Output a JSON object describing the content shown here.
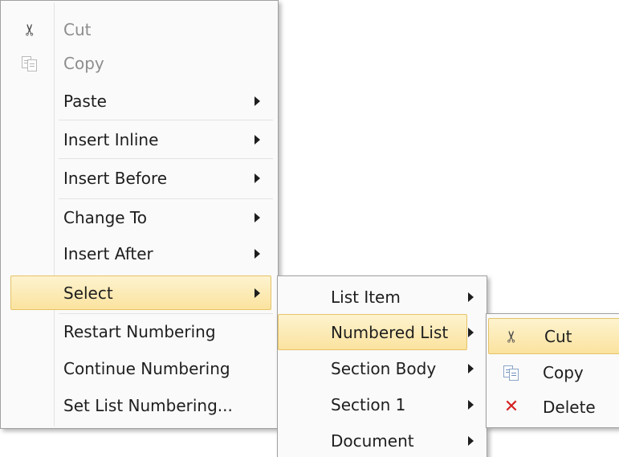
{
  "context_menu": {
    "items": [
      {
        "label": "Cut",
        "icon": "scissors-icon"
      },
      {
        "label": "Copy",
        "icon": "copy-icon"
      },
      {
        "label": "Paste"
      },
      {
        "label": "Insert Inline"
      },
      {
        "label": "Insert Before"
      },
      {
        "label": "Change To"
      },
      {
        "label": "Insert After"
      },
      {
        "label": "Select"
      },
      {
        "label": "Restart Numbering"
      },
      {
        "label": "Continue Numbering"
      },
      {
        "label": "Set List Numbering..."
      }
    ]
  },
  "select_submenu": {
    "items": [
      {
        "label": "List Item"
      },
      {
        "label": "Numbered List"
      },
      {
        "label": "Section Body"
      },
      {
        "label": "Section 1"
      },
      {
        "label": "Document"
      }
    ]
  },
  "numbered_list_submenu": {
    "items": [
      {
        "label": "Cut",
        "icon": "scissors-icon"
      },
      {
        "label": "Copy",
        "icon": "copy-icon"
      },
      {
        "label": "Delete",
        "icon": "delete-icon"
      }
    ]
  },
  "colors": {
    "highlight": "#fbe39f",
    "highlight_border": "#e5c367",
    "menu_background": "#fafafa",
    "disabled_text": "#8d8d8d",
    "delete_icon": "#d42121"
  }
}
